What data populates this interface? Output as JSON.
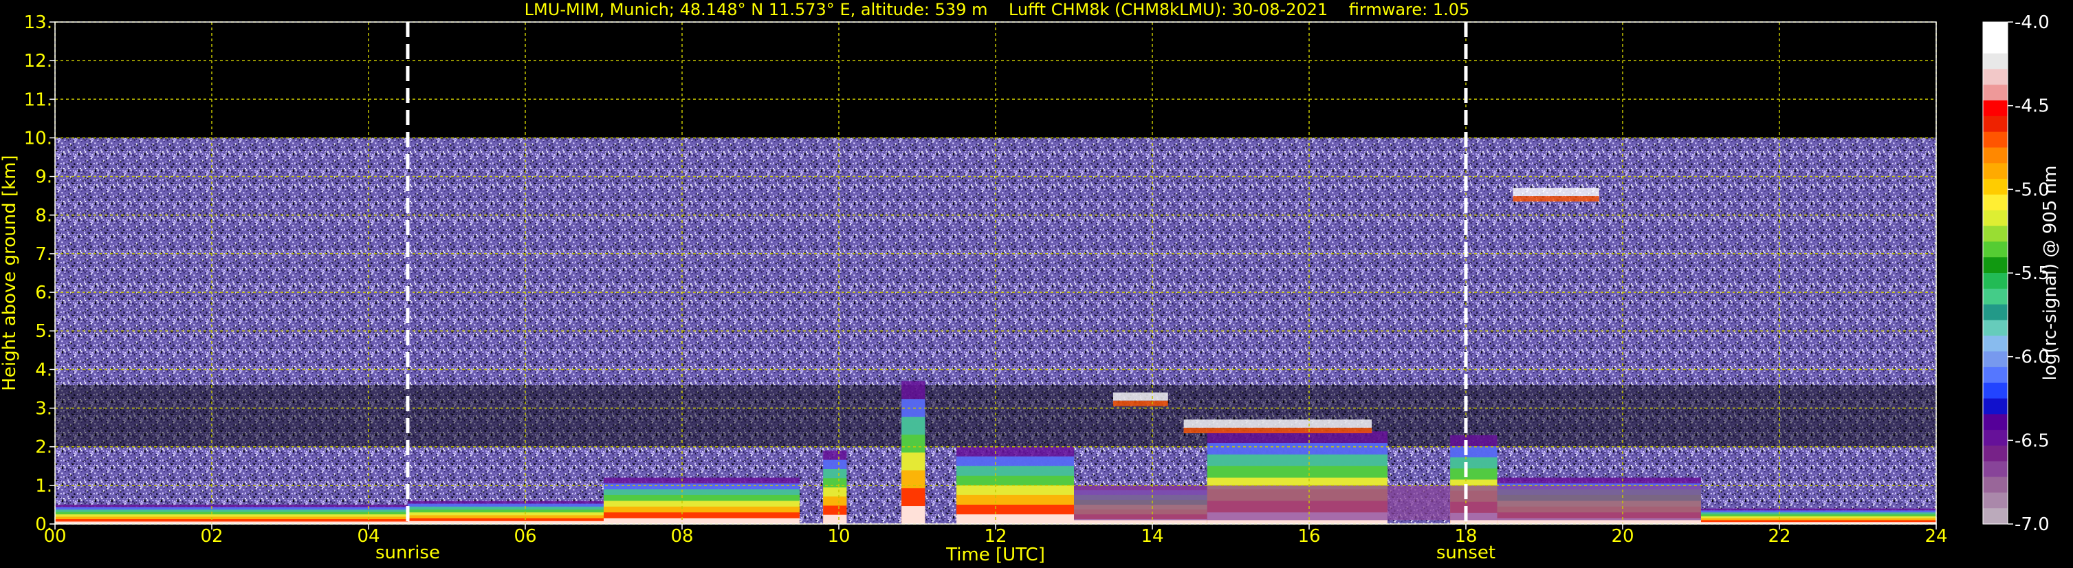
{
  "chart_data": {
    "type": "heatmap",
    "title": "LMU-MIM, Munich; 48.148° N 11.573° E, altitude: 539 m    Lufft CHM8k (CHM8kLMU): 30-08-2021    firmware: 1.05",
    "xlabel": "Time [UTC]",
    "ylabel": "Height above ground [km]",
    "xlim": [
      0,
      24
    ],
    "ylim": [
      0,
      13
    ],
    "x_ticks": [
      "00",
      "02",
      "04",
      "06",
      "08",
      "10",
      "12",
      "14",
      "16",
      "18",
      "20",
      "22",
      "24"
    ],
    "y_ticks": [
      "0.",
      "1.",
      "2.",
      "3.",
      "4.",
      "5.",
      "6.",
      "7.",
      "8.",
      "9.",
      "10.",
      "11.",
      "12.",
      "13."
    ],
    "grid": true,
    "grid_color": "#c8c800",
    "text_color": "#ffff00",
    "background": "#000000",
    "data_max_height_km": 10.0,
    "noise_color": "#6a5cb0",
    "markers": [
      {
        "label": "sunrise",
        "time_h": 4.5
      },
      {
        "label": "sunset",
        "time_h": 18.0
      }
    ],
    "boundary_layer_features": [
      {
        "start_h": 0.0,
        "end_h": 4.5,
        "top_km": 0.5
      },
      {
        "start_h": 4.5,
        "end_h": 7.0,
        "top_km": 0.6
      },
      {
        "start_h": 7.0,
        "end_h": 9.5,
        "top_km": 1.2
      },
      {
        "start_h": 9.8,
        "end_h": 10.1,
        "top_km": 1.9
      },
      {
        "start_h": 10.8,
        "end_h": 11.1,
        "top_km": 3.7
      },
      {
        "start_h": 11.5,
        "end_h": 13.0,
        "top_km": 2.0
      },
      {
        "start_h": 13.0,
        "end_h": 14.7,
        "top_km": 1.0
      },
      {
        "start_h": 14.7,
        "end_h": 17.0,
        "top_km": 2.4
      },
      {
        "start_h": 17.8,
        "end_h": 18.4,
        "top_km": 2.3
      },
      {
        "start_h": 18.4,
        "end_h": 21.0,
        "top_km": 1.2
      },
      {
        "start_h": 21.0,
        "end_h": 24.0,
        "top_km": 0.4
      }
    ],
    "elevated_layers": [
      {
        "start_h": 13.5,
        "end_h": 14.2,
        "height_km": 3.3
      },
      {
        "start_h": 14.4,
        "end_h": 16.8,
        "height_km": 2.6
      },
      {
        "start_h": 18.6,
        "end_h": 19.7,
        "height_km": 8.6
      }
    ],
    "colorbar": {
      "label": "log(rc-signal) @ 905 nm",
      "min": -7.0,
      "max": -4.0,
      "ticks": [
        "-4.0",
        "-4.5",
        "-5.0",
        "-5.5",
        "-6.0",
        "-6.5",
        "-7.0"
      ],
      "colors": [
        "#ffffff",
        "#ffffff",
        "#e8e8e8",
        "#f2c8c8",
        "#ee9999",
        "#ff0000",
        "#ee2200",
        "#ff5500",
        "#ff8800",
        "#ffaa00",
        "#ffcc00",
        "#ffee33",
        "#ddee33",
        "#99dd33",
        "#55cc33",
        "#119911",
        "#22bb55",
        "#44cc88",
        "#229988",
        "#66ccbb",
        "#88bbee",
        "#7799ee",
        "#5577ff",
        "#2244ff",
        "#1111cc",
        "#550099",
        "#661199",
        "#772288",
        "#884499",
        "#996699",
        "#aa88aa",
        "#bbaabb"
      ]
    }
  }
}
